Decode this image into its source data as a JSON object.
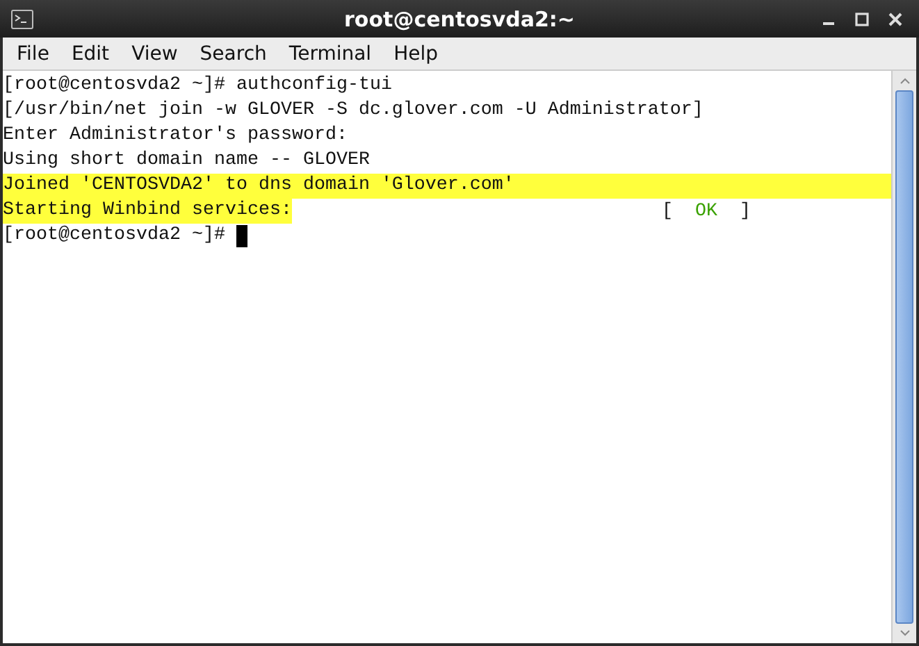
{
  "window": {
    "title": "root@centosvda2:~"
  },
  "menu": [
    "File",
    "Edit",
    "View",
    "Search",
    "Terminal",
    "Help"
  ],
  "terminal": {
    "lines": [
      {
        "text": "[root@centosvda2 ~]# authconfig-tui",
        "highlighted": false
      },
      {
        "text": "[/usr/bin/net join -w GLOVER -S dc.glover.com -U Administrator]",
        "highlighted": false
      },
      {
        "text": "Enter Administrator's password:",
        "highlighted": false
      },
      {
        "text": "Using short domain name -- GLOVER",
        "highlighted": false
      },
      {
        "text": "Joined 'CENTOSVDA2' to dns domain 'Glover.com'",
        "highlighted": true
      },
      {
        "text": "Starting Winbind services:",
        "highlighted": true,
        "partial": true,
        "status": {
          "open": "[",
          "word": "OK",
          "close": "]"
        }
      },
      {
        "text": "[root@centosvda2 ~]#",
        "highlighted": false,
        "cursor": true
      }
    ]
  }
}
